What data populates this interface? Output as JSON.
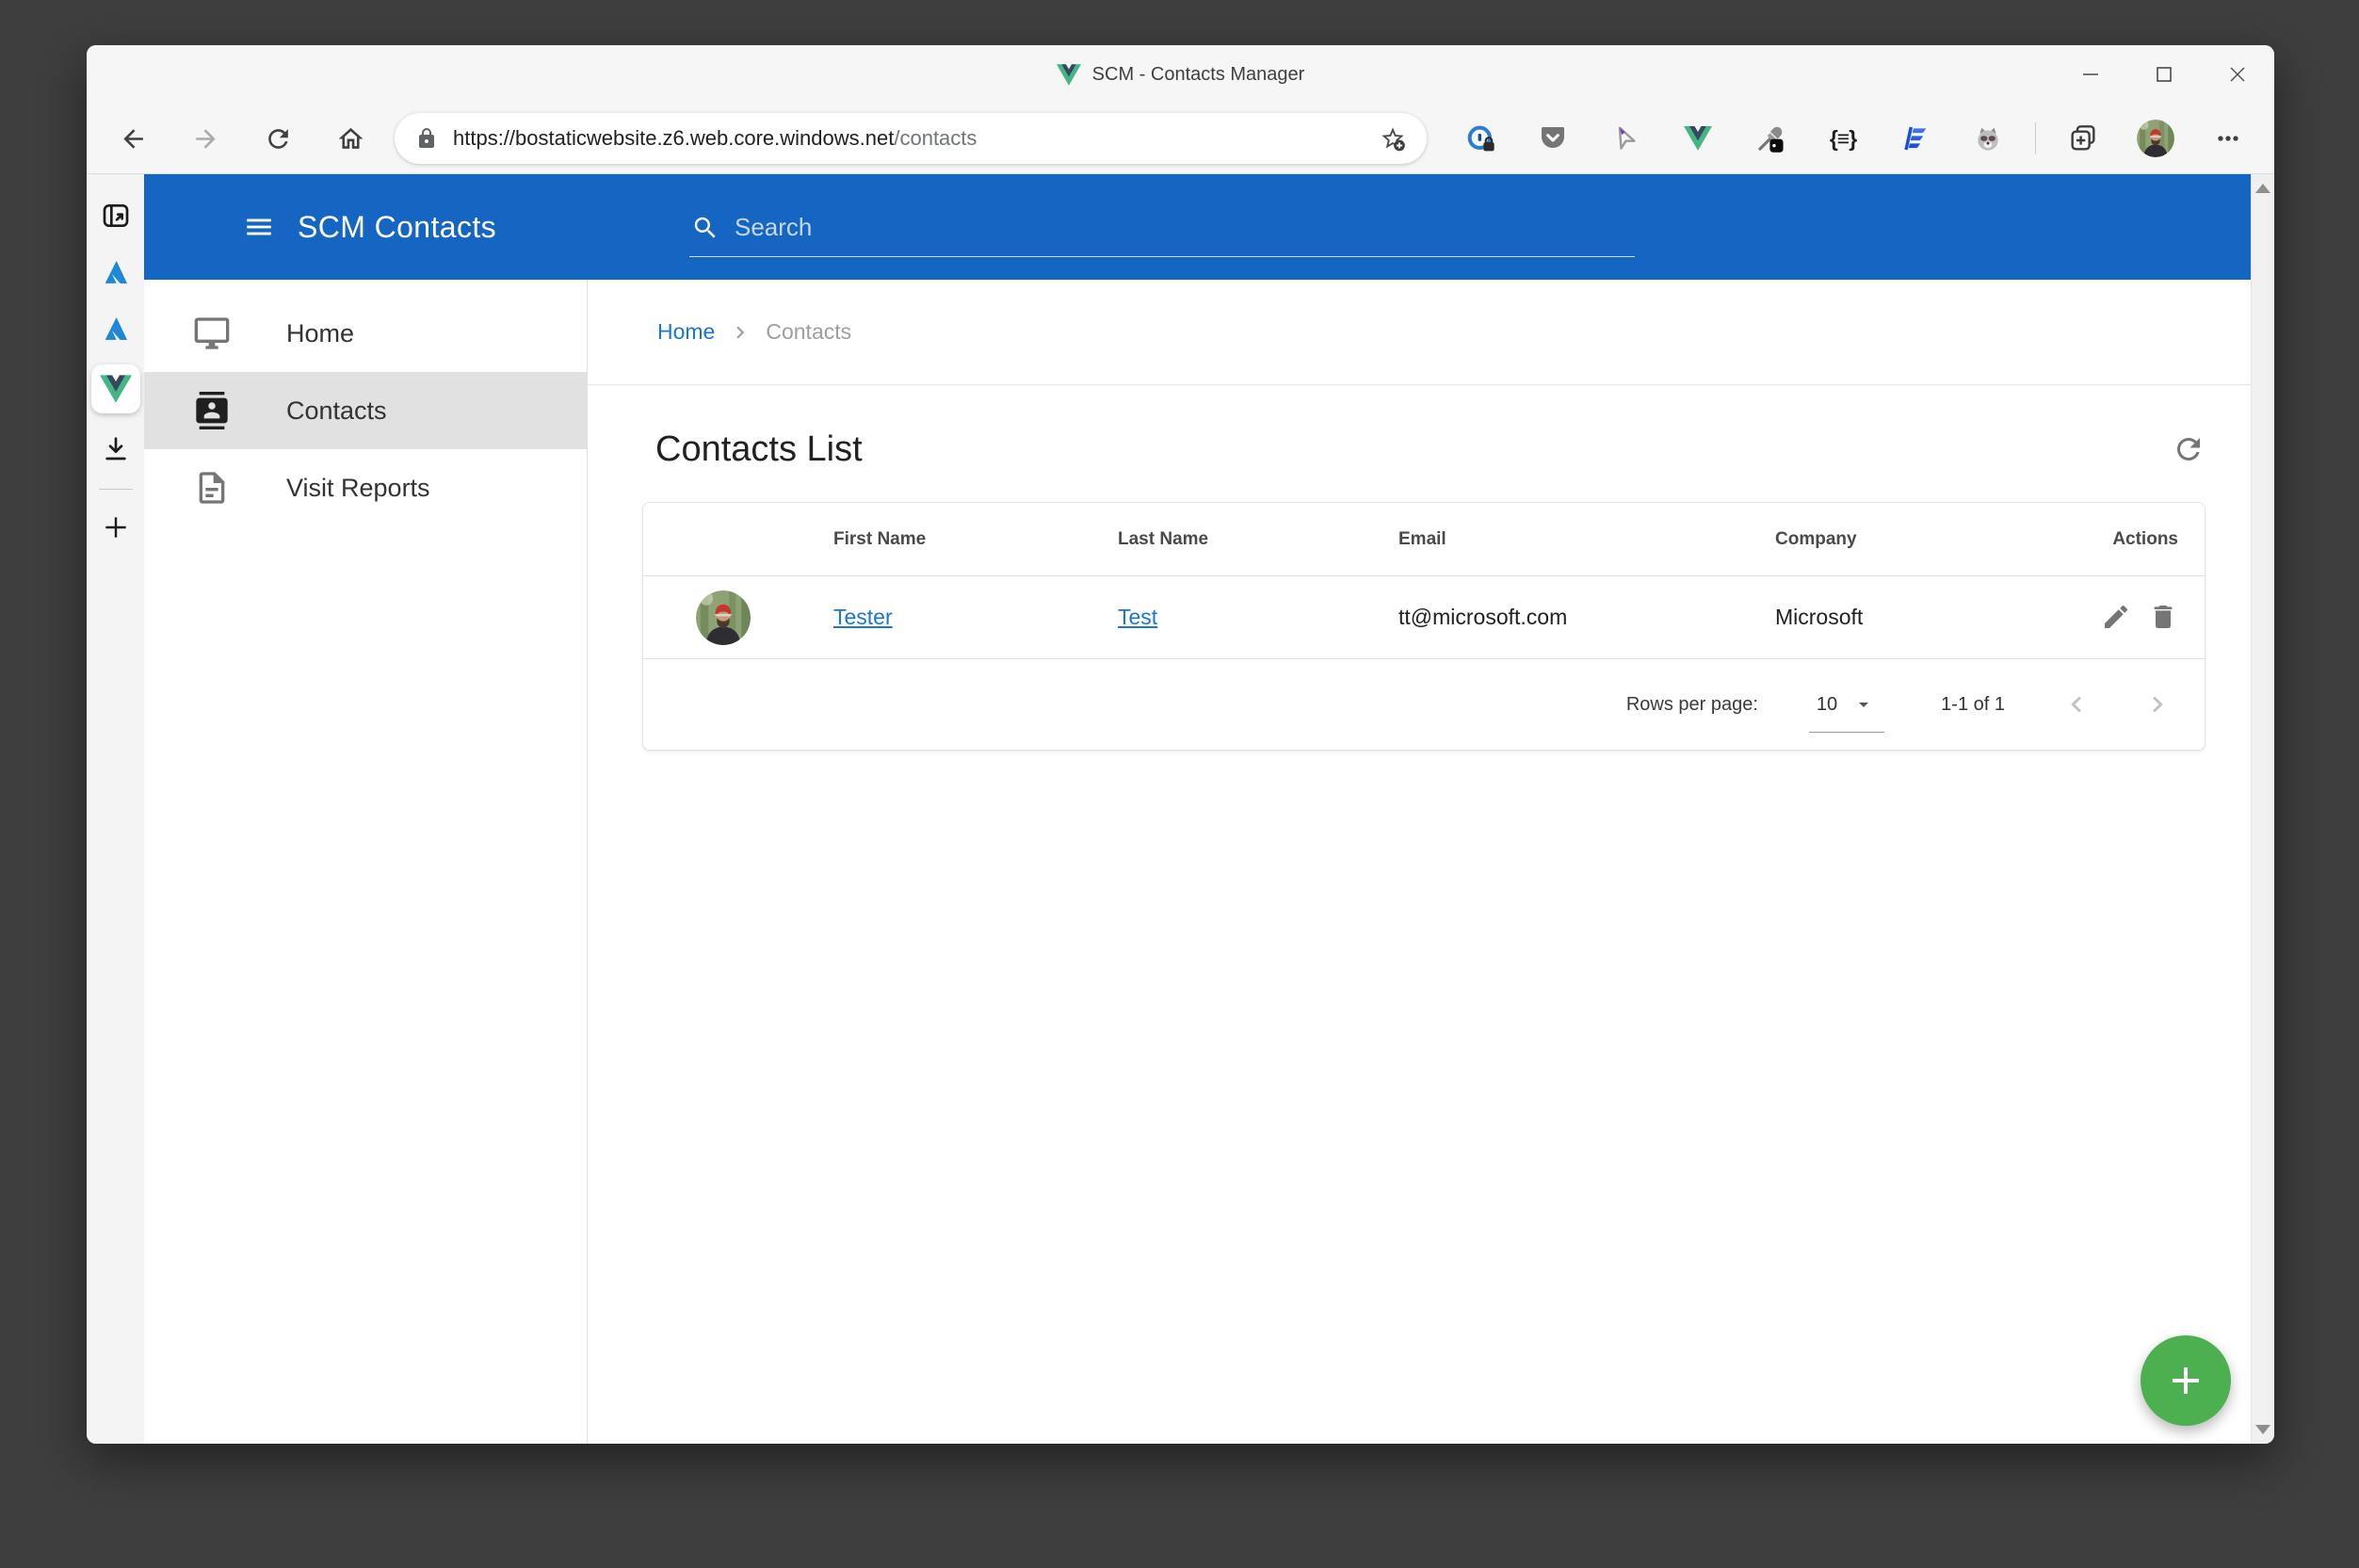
{
  "colors": {
    "appbar_blue": "#1565C2",
    "link_blue": "#1976D2",
    "fab_green": "#4CAF50",
    "desktop_gray": "#3E3E3E",
    "active_nav_gray": "#E1E1E1"
  },
  "browser": {
    "window_title": "SCM - Contacts Manager",
    "url": {
      "scheme_host": "https://bostaticwebsite.z6.web.core.windows.net",
      "path": "/contacts"
    },
    "icons": {
      "json_badge": "{≡}"
    }
  },
  "app": {
    "appbar": {
      "title": "SCM Contacts",
      "search_placeholder": "Search"
    },
    "nav": {
      "items": [
        {
          "label": "Home"
        },
        {
          "label": "Contacts"
        },
        {
          "label": "Visit Reports"
        }
      ]
    },
    "breadcrumb": {
      "home": "Home",
      "current": "Contacts"
    },
    "page_title": "Contacts List",
    "table": {
      "headers": [
        "First Name",
        "Last Name",
        "Email",
        "Company",
        "Actions"
      ],
      "rows": [
        {
          "first_name": "Tester",
          "last_name": "Test",
          "email": "tt@microsoft.com",
          "company": "Microsoft"
        }
      ],
      "pagination": {
        "rows_per_page_label": "Rows per page:",
        "rows_per_page_value": "10",
        "range_text": "1-1 of 1"
      }
    }
  }
}
